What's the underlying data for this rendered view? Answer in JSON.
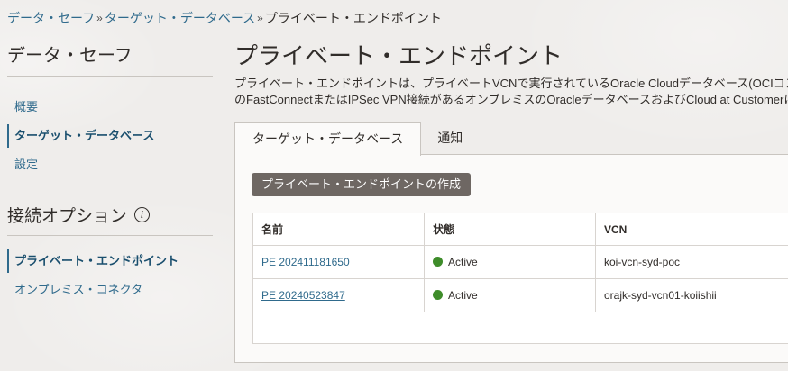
{
  "breadcrumb": {
    "items": [
      "データ・セーフ",
      "ターゲット・データベース"
    ],
    "separator": "»",
    "current": "プライベート・エンドポイント"
  },
  "sidebar": {
    "title": "データ・セーフ",
    "items": [
      {
        "label": "概要",
        "active": false
      },
      {
        "label": "ターゲット・データベース",
        "active": true
      },
      {
        "label": "設定",
        "active": false
      }
    ],
    "section_title": "接続オプション",
    "section_info_icon": "info-icon",
    "section_items": [
      {
        "label": "プライベート・エンドポイント",
        "active": true
      },
      {
        "label": "オンプレミス・コネクタ",
        "active": false
      }
    ]
  },
  "main": {
    "title": "プライベート・エンドポイント",
    "description_line1": "プライベート・エンドポイントは、プライベートVCNで実行されているOracle Cloudデータベース(OCIコンピ",
    "description_line2": "のFastConnectまたはIPSec VPN接続があるオンプレミスのOracleデータベースおよびCloud at Customerに接",
    "tabs": [
      {
        "label": "ターゲット・データベース",
        "active": true
      },
      {
        "label": "通知",
        "active": false
      }
    ],
    "create_button": "プライベート・エンドポイントの作成",
    "table": {
      "columns": [
        "名前",
        "状態",
        "VCN"
      ],
      "rows": [
        {
          "name": "PE 202411181650",
          "status": "Active",
          "vcn": "koi-vcn-syd-poc"
        },
        {
          "name": "PE 20240523847",
          "status": "Active",
          "vcn": "orajk-syd-vcn01-koiishii"
        }
      ]
    }
  },
  "colors": {
    "link": "#2f6a8c",
    "active_status": "#3e8c2a",
    "button_bg": "#6e6763"
  }
}
